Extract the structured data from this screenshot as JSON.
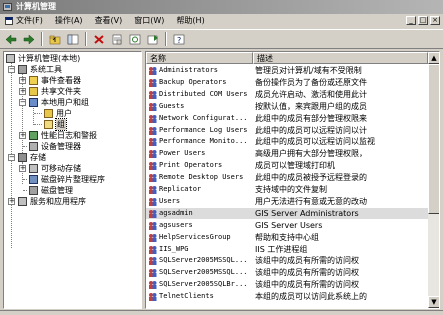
{
  "window": {
    "title": "计算机管理"
  },
  "menu": {
    "items": [
      "文件(F)",
      "操作(A)",
      "查看(V)",
      "窗口(W)",
      "帮助(H)"
    ],
    "mdi_controls": [
      "_",
      "□",
      "×"
    ]
  },
  "toolbar": {
    "buttons": [
      "back-arrow-icon",
      "forward-arrow-icon",
      "up-folder-icon",
      "show-tree-icon",
      "delete-icon",
      "properties-icon",
      "refresh-icon",
      "export-list-icon",
      "help-icon"
    ]
  },
  "tree": {
    "root": "计算机管理(本地)",
    "items": [
      {
        "label": "系统工具",
        "expander": "−"
      },
      {
        "label": "事件查看器",
        "expander": "+"
      },
      {
        "label": "共享文件夹",
        "expander": "+"
      },
      {
        "label": "本地用户和组",
        "expander": "−"
      },
      {
        "label": "用户"
      },
      {
        "label": "组"
      },
      {
        "label": "性能日志和警报",
        "expander": "+"
      },
      {
        "label": "设备管理器"
      },
      {
        "label": "存储",
        "expander": "−"
      },
      {
        "label": "可移动存储",
        "expander": "+"
      },
      {
        "label": "磁盘碎片整理程序"
      },
      {
        "label": "磁盘管理"
      },
      {
        "label": "服务和应用程序",
        "expander": "+"
      }
    ]
  },
  "list": {
    "columns": [
      "名称",
      "描述"
    ],
    "rows": [
      {
        "name": "Administrators",
        "desc": "管理员对计算机/域有不受限制"
      },
      {
        "name": "Backup Operators",
        "desc": "备份操作员为了备份或还原文件"
      },
      {
        "name": "Distributed COM Users",
        "desc": "成员允许启动、激活和使用此计"
      },
      {
        "name": "Guests",
        "desc": "按默认值，来宾跟用户组的成员"
      },
      {
        "name": "Network Configurat...",
        "desc": "此组中的成员有部分管理权限来"
      },
      {
        "name": "Performance Log Users",
        "desc": "此组中的成员可以远程访问以计"
      },
      {
        "name": "Performance Monito...",
        "desc": "此组中的成员可以远程访问以监视"
      },
      {
        "name": "Power Users",
        "desc": "高级用户拥有大部分管理权限，"
      },
      {
        "name": "Print Operators",
        "desc": "成员可以管理域打印机"
      },
      {
        "name": "Remote Desktop Users",
        "desc": "此组中的成员被授予远程登录的"
      },
      {
        "name": "Replicator",
        "desc": "支持域中的文件复制"
      },
      {
        "name": "Users",
        "desc": "用户无法进行有意或无意的改动"
      },
      {
        "name": "agsadmin",
        "desc": "GIS Server Administrators"
      },
      {
        "name": "agsusers",
        "desc": "GIS Server Users"
      },
      {
        "name": "HelpServicesGroup",
        "desc": "帮助和支持中心组"
      },
      {
        "name": "IIS_WPG",
        "desc": "IIS 工作进程组"
      },
      {
        "name": "SQLServer2005MSSQL...",
        "desc": "该组中的成员有所需的访问权"
      },
      {
        "name": "SQLServer2005MSSQL...",
        "desc": "该组中的成员有所需的访问权"
      },
      {
        "name": "SQLServer2005SQLBr...",
        "desc": "该组中的成员有所需的访问权"
      },
      {
        "name": "TelnetClients",
        "desc": "本组的成员可以访问此系统上的"
      }
    ],
    "selected_index": 12
  },
  "scrollbar": {
    "up": "▲",
    "down": "▼"
  }
}
